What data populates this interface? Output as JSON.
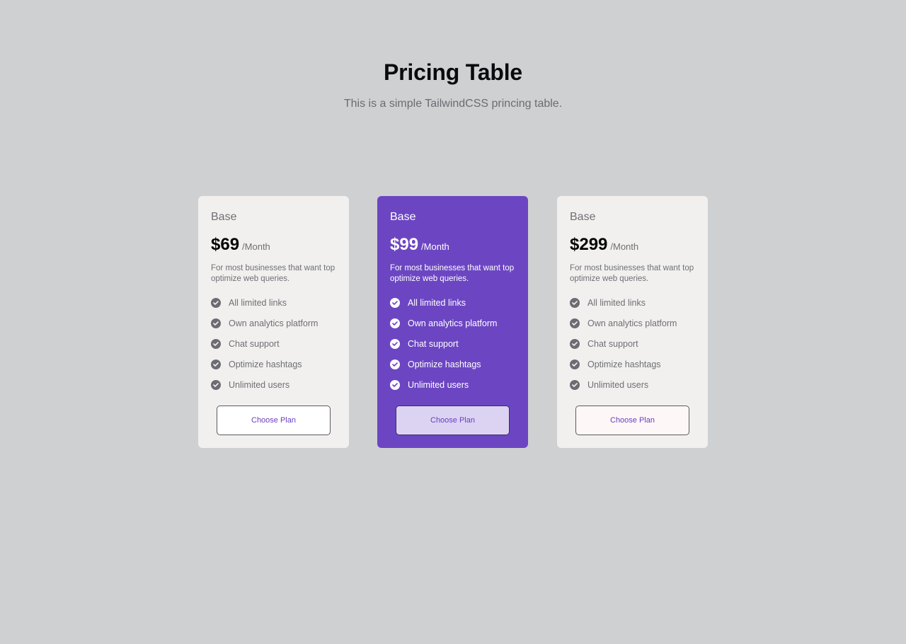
{
  "header": {
    "title": "Pricing Table",
    "subtitle": "This is a simple TailwindCSS princing table."
  },
  "plans": [
    {
      "name": "Base",
      "price": "$69",
      "period": "/Month",
      "description": "For most businesses that want top optimize web queries.",
      "features": [
        "All limited links",
        "Own analytics platform",
        "Chat support",
        "Optimize hashtags",
        "Unlimited users"
      ],
      "button": "Choose Plan"
    },
    {
      "name": "Base",
      "price": "$99",
      "period": "/Month",
      "description": "For most businesses that want top optimize web queries.",
      "features": [
        "All limited links",
        "Own analytics platform",
        "Chat support",
        "Optimize hashtags",
        "Unlimited users"
      ],
      "button": "Choose Plan"
    },
    {
      "name": "Base",
      "price": "$299",
      "period": "/Month",
      "description": "For most businesses that want top optimize web queries.",
      "features": [
        "All limited links",
        "Own analytics platform",
        "Chat support",
        "Optimize hashtags",
        "Unlimited users"
      ],
      "button": "Choose Plan"
    }
  ],
  "colors": {
    "background": "#cfd0d2",
    "card": "#f1f0ef",
    "featured": "#6c46c2",
    "accent_text": "#6a3fc0"
  },
  "icons": {
    "feature": "check-circle-icon"
  }
}
